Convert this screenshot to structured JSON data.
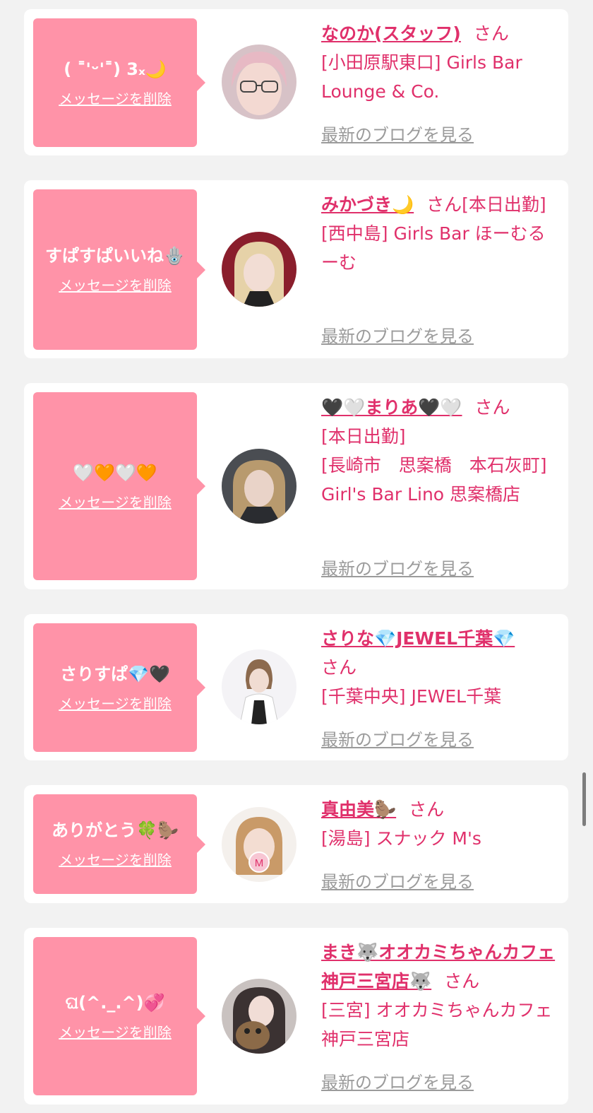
{
  "delete_label": "メッセージを削除",
  "blog_label": "最新のブログを見る",
  "san_label": "さん",
  "colors": {
    "accent": "#e0306b",
    "bubble": "#ff93a8",
    "background": "#f2f2f2",
    "muted": "#9b9b9b"
  },
  "messages": [
    {
      "message": "( ˭'ᵕ'˭) 3ₓ🌙",
      "name": "なのか(スタッフ)",
      "status": "",
      "shop": "[小田原駅東口] Girls Bar Lounge & Co."
    },
    {
      "message": "すぱすぱいいね🪬",
      "name": "みかづき🌙",
      "status": "[本日出勤]",
      "shop": "[西中島] Girls Bar ほーむるーむ"
    },
    {
      "message": "🤍🧡🤍🧡",
      "name": "🖤🤍まりあ🖤🤍",
      "status": "[本日出勤]",
      "shop": "[長崎市　思案橋　本石灰町] Girl's Bar Lino 思案橋店"
    },
    {
      "message": "さりすぱ💎🖤",
      "name": "さりな💎JEWEL千葉💎",
      "status": "",
      "shop": "[千葉中央] JEWEL千葉"
    },
    {
      "message": "ありがとう🍀🦫",
      "name": "真由美🦫",
      "status": "",
      "shop": "[湯島] スナック M's"
    },
    {
      "message": "ଘ(^._.^)💞",
      "name": "まき🐺オオカミちゃんカフェ神戸三宮店🐺",
      "status": "",
      "shop": "[三宮] オオカミちゃんカフェ神戸三宮店"
    }
  ]
}
